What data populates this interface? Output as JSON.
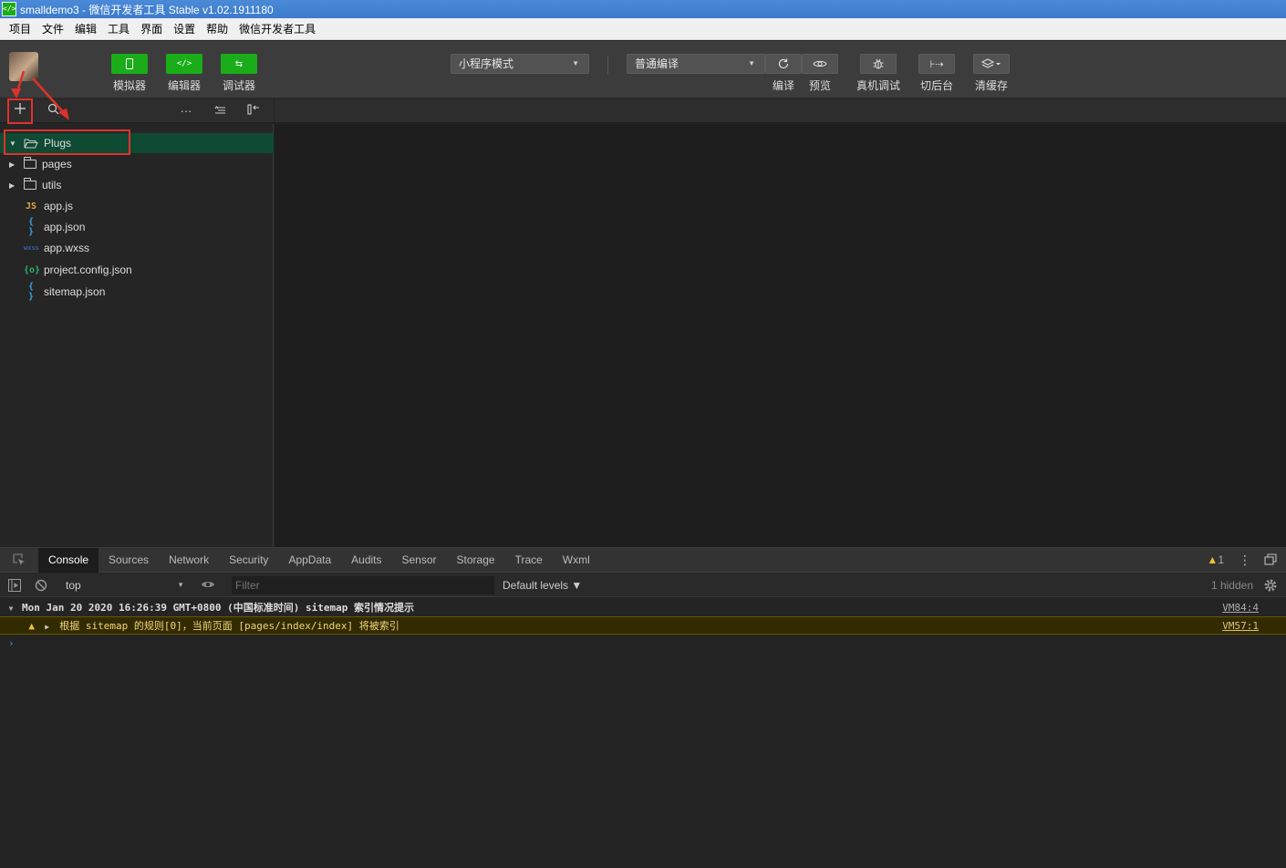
{
  "window": {
    "title": "smalldemo3 - 微信开发者工具 Stable v1.02.1911180"
  },
  "menu": [
    "项目",
    "文件",
    "编辑",
    "工具",
    "界面",
    "设置",
    "帮助",
    "微信开发者工具"
  ],
  "toolbar": {
    "simulator": "模拟器",
    "editor": "编辑器",
    "debugger": "调试器",
    "mode_select": "小程序模式",
    "compile_select": "普通编译",
    "compile": "编译",
    "preview": "预览",
    "remote_debug": "真机调试",
    "background": "切后台",
    "clear_cache": "清缓存"
  },
  "tree": [
    {
      "name": "Plugs",
      "type": "folder",
      "expanded": true,
      "selected": true
    },
    {
      "name": "pages",
      "type": "folder",
      "expanded": false
    },
    {
      "name": "utils",
      "type": "folder",
      "expanded": false
    },
    {
      "name": "app.js",
      "type": "js",
      "icon": "JS",
      "color": "#e5a73b"
    },
    {
      "name": "app.json",
      "type": "json",
      "icon": "{ }",
      "color": "#3ba1e0"
    },
    {
      "name": "app.wxss",
      "type": "wxss",
      "icon": "wxss",
      "color": "#3b7be0"
    },
    {
      "name": "project.config.json",
      "type": "config",
      "icon": "{o}",
      "color": "#2fb36b"
    },
    {
      "name": "sitemap.json",
      "type": "json",
      "icon": "{ }",
      "color": "#3ba1e0"
    }
  ],
  "devtools": {
    "tabs": [
      "Console",
      "Sources",
      "Network",
      "Security",
      "AppData",
      "Audits",
      "Sensor",
      "Storage",
      "Trace",
      "Wxml"
    ],
    "active_tab": "Console",
    "warning_count": "1",
    "context": "top",
    "filter_placeholder": "Filter",
    "levels": "Default levels ▼",
    "hidden": "1 hidden",
    "group_header": "Mon Jan 20 2020 16:26:39 GMT+0800 (中国标准时间) sitemap 索引情况提示",
    "group_source": "VM84:4",
    "warning_text": "根据 sitemap 的规则[0]，当前页面 [pages/index/index] 将被索引",
    "warning_source": "VM57:1"
  },
  "colors": {
    "accent": "#1aad19",
    "selection": "#0f4a33",
    "annotation": "#e0322b"
  }
}
